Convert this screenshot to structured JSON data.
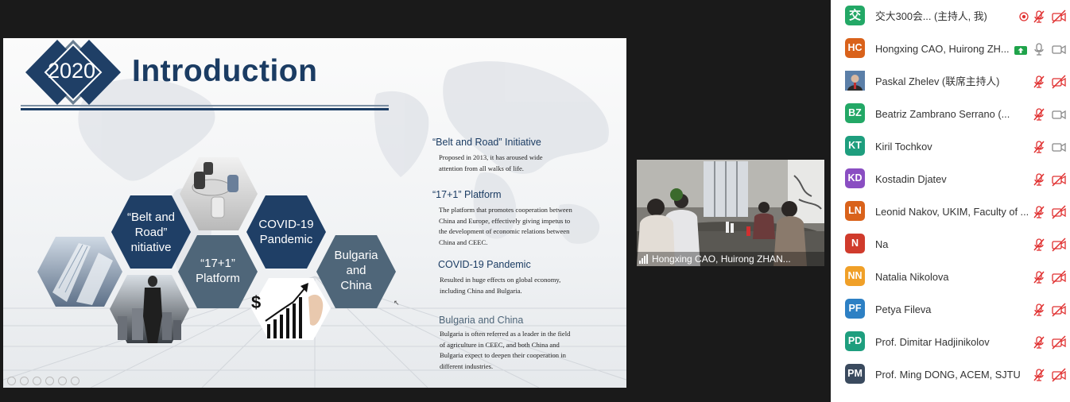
{
  "slide": {
    "year": "2020",
    "title": "Introduction",
    "hexagons": {
      "belt_road": "“Belt and Road” Initiative",
      "platform": "“17+1” Platform",
      "covid": "COVID-19 Pandemic",
      "bulgaria_china": "Bulgaria and China"
    },
    "sections": [
      {
        "heading": "“Belt and Road” Initiative",
        "body": "Proposed in 2013, it has aroused wide attention from all walks of life."
      },
      {
        "heading": "“17+1” Platform",
        "body": "The platform that promotes cooperation between China and Europe, effectively giving impetus to the development of economic relations between China and CEEC."
      },
      {
        "heading": "COVID-19 Pandemic",
        "body": "Resulted in huge effects on global economy, including China and Bulgaria."
      },
      {
        "heading": "Bulgaria and China",
        "body": "Bulgaria is often referred as a leader in the field of agriculture in CEEC, and both China and Bulgaria expect to deepen their cooperation in different industries."
      }
    ]
  },
  "video": {
    "participant_name": "Hongxing CAO, Huirong ZHAN..."
  },
  "participants": [
    {
      "initials": "交",
      "name": "交大300会...   (主持人, 我)",
      "color": "#23a866",
      "mic": "muted",
      "camera": "off",
      "recording": true
    },
    {
      "initials": "HC",
      "name": "Hongxing CAO, Huirong ZH...",
      "color": "#d9621b",
      "mic": "on",
      "camera": "on",
      "sharing": true
    },
    {
      "initials": "",
      "name": "Paskal Zhelev (联席主持人)",
      "color": "#4a6e9a",
      "mic": "muted",
      "camera": "off",
      "photo": true
    },
    {
      "initials": "BZ",
      "name": "Beatriz Zambrano Serrano    (...",
      "color": "#23a866",
      "mic": "muted",
      "camera": "on"
    },
    {
      "initials": "KT",
      "name": "Kiril Tochkov",
      "color": "#1e9e7e",
      "mic": "muted",
      "camera": "on"
    },
    {
      "initials": "KD",
      "name": "Kostadin Djatev",
      "color": "#8a4ec2",
      "mic": "muted",
      "camera": "off"
    },
    {
      "initials": "LN",
      "name": "Leonid Nakov, UKIM, Faculty of ...",
      "color": "#d9621b",
      "mic": "muted",
      "camera": "off"
    },
    {
      "initials": "N",
      "name": "Na",
      "color": "#d03b2c",
      "mic": "muted",
      "camera": "off"
    },
    {
      "initials": "NN",
      "name": "Natalia Nikolova",
      "color": "#f0a028",
      "mic": "muted",
      "camera": "off"
    },
    {
      "initials": "PF",
      "name": "Petya Fileva",
      "color": "#2d80c4",
      "mic": "muted",
      "camera": "off"
    },
    {
      "initials": "PD",
      "name": "Prof. Dimitar Hadjinikolov",
      "color": "#1e9e7e",
      "mic": "muted",
      "camera": "off"
    },
    {
      "initials": "PM",
      "name": "Prof. Ming DONG, ACEM, SJTU",
      "color": "#3a4a5e",
      "mic": "muted",
      "camera": "off"
    }
  ],
  "colors": {
    "mute_red": "#e03030",
    "title_navy": "#1b3c63",
    "hex_blue": "#1f3f66",
    "hex_slate": "#4f6679"
  }
}
